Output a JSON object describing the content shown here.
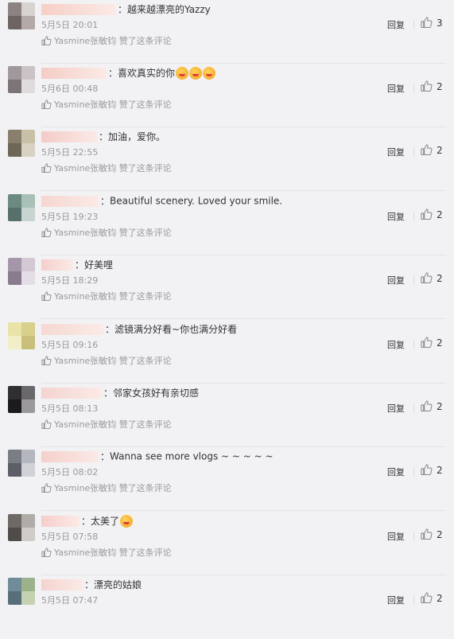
{
  "comments": [
    {
      "nick": "",
      "text": "越来越漂亮的Yazzy",
      "emojis": 0,
      "date": "5月5日 20:01",
      "liked_by": "Yasmine张敏钧",
      "liked_label": "赞了这条评论",
      "reply_label": "回复",
      "likes": "3",
      "nick_color": "#f7cfc6",
      "nick_width": 94,
      "avatar_colors": [
        "#8c8282",
        "#d7d3d0",
        "#6d6462",
        "#b3aaa8"
      ]
    },
    {
      "nick": "",
      "text": "喜欢真实的你",
      "emojis": 3,
      "date": "5月6日 00:48",
      "liked_by": "Yasmine张敏钧",
      "liked_label": "赞了这条评论",
      "reply_label": "回复",
      "likes": "2",
      "nick_color": "#f5ccc6",
      "nick_width": 82,
      "avatar_colors": [
        "#a0989c",
        "#c9c3c5",
        "#7c7477",
        "#e0dcdd"
      ]
    },
    {
      "nick": "",
      "text": "加油，爱你。",
      "emojis": 0,
      "date": "5月5日 22:55",
      "liked_by": "Yasmine张敏钧",
      "liked_label": "赞了这条评论",
      "reply_label": "回复",
      "likes": "2",
      "nick_color": "#f4cbc8",
      "nick_width": 70,
      "avatar_colors": [
        "#8a7e6c",
        "#c9c0a8",
        "#6e6656",
        "#d8d2c4"
      ]
    },
    {
      "nick": "",
      "text": "Beautiful scenery. Loved your smile.",
      "emojis": 0,
      "date": "5月5日 19:23",
      "liked_by": "Yasmine张敏钧",
      "liked_label": "赞了这条评论",
      "reply_label": "回复",
      "likes": "2",
      "nick_color": "#f6d6d0",
      "nick_width": 72,
      "avatar_colors": [
        "#6a8a82",
        "#a9c0b8",
        "#57706c",
        "#c8d4cf"
      ]
    },
    {
      "nick": "",
      "text": "好美哩",
      "emojis": 0,
      "date": "5月5日 18:29",
      "liked_by": "Yasmine张敏钧",
      "liked_label": "赞了这条评论",
      "reply_label": "回复",
      "likes": "2",
      "nick_color": "#f5cfcc",
      "nick_width": 40,
      "avatar_colors": [
        "#a597a9",
        "#d3c8d4",
        "#8a7c8e",
        "#e4dde5"
      ]
    },
    {
      "nick": "",
      "text": "滤镜满分好看~你也满分好看",
      "emojis": 0,
      "date": "5月5日 09:16",
      "liked_by": "Yasmine张敏钧",
      "liked_label": "赞了这条评论",
      "reply_label": "回复",
      "likes": "2",
      "nick_color": "#f6d9d2",
      "nick_width": 78,
      "avatar_colors": [
        "#e9e3a8",
        "#d8d08c",
        "#f2eec8",
        "#c8c07a"
      ]
    },
    {
      "nick": "",
      "text": "邻家女孩好有亲切感",
      "emojis": 0,
      "date": "5月5日 08:13",
      "liked_by": "Yasmine张敏钧",
      "liked_label": "赞了这条评论",
      "reply_label": "回复",
      "likes": "2",
      "nick_color": "#f4d4d0",
      "nick_width": 76,
      "avatar_colors": [
        "#2f2e31",
        "#6a686d",
        "#1b1a1d",
        "#9b999e"
      ]
    },
    {
      "nick": "",
      "text": "Wanna see more vlogs ~ ~ ~ ~ ~",
      "emojis": 0,
      "date": "5月5日 08:02",
      "liked_by": "Yasmine张敏钧",
      "liked_label": "赞了这条评论",
      "reply_label": "回复",
      "likes": "2",
      "nick_color": "#f5d0cc",
      "nick_width": 72,
      "avatar_colors": [
        "#7a7c86",
        "#b5b7c0",
        "#5d5f68",
        "#d1d2d8"
      ]
    },
    {
      "nick": "",
      "text": "太美了",
      "emojis": 1,
      "date": "5月5日 07:58",
      "liked_by": "Yasmine张敏钧",
      "liked_label": "赞了这条评论",
      "reply_label": "回复",
      "likes": "2",
      "nick_color": "#f5cecb",
      "nick_width": 48,
      "avatar_colors": [
        "#6d6a66",
        "#b0ada8",
        "#4f4c49",
        "#cfccc7"
      ]
    },
    {
      "nick": "",
      "text": "漂亮的姑娘",
      "emojis": 0,
      "date": "5月5日 07:47",
      "liked_by": "",
      "liked_label": "",
      "reply_label": "回复",
      "likes": "2",
      "nick_color": "#f5d3cf",
      "nick_width": 52,
      "avatar_colors": [
        "#6f8c98",
        "#9bb28a",
        "#586f7a",
        "#c4d2b2"
      ]
    }
  ],
  "icons": {
    "thumb": "thumbs-up-icon"
  }
}
